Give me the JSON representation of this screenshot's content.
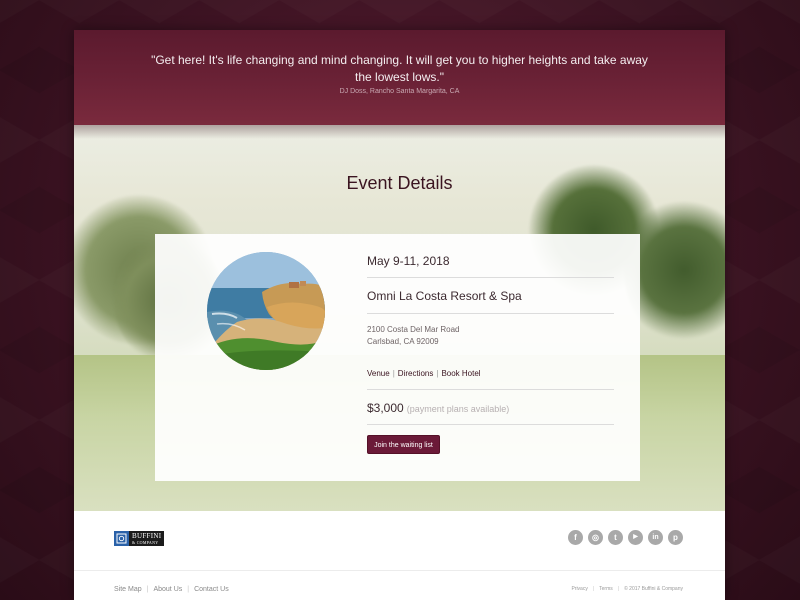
{
  "testimonial": {
    "quote": "\"Get here! It's life changing and mind changing. It will get you to higher heights and take away the lowest lows.\"",
    "author": "DJ Doss, Rancho Santa Margarita, CA"
  },
  "event": {
    "title": "Event Details",
    "date": "May 9-11, 2018",
    "venue": "Omni La Costa Resort & Spa",
    "address_line1": "2100 Costa Del Mar Road",
    "address_line2": "Carlsbad, CA 92009",
    "links": {
      "venue": "Venue",
      "separator": "|",
      "directions": "Directions",
      "book_hotel": "Book Hotel"
    },
    "price": "$3,000",
    "price_note": "(payment plans available)",
    "cta_label": "Join the waiting list"
  },
  "footer": {
    "logo": {
      "line1": "BUFFINI",
      "line2": "& COMPANY"
    },
    "social_icons": [
      {
        "name": "facebook-icon",
        "glyph": "f"
      },
      {
        "name": "instagram-icon",
        "glyph": "◎"
      },
      {
        "name": "twitter-icon",
        "glyph": "t"
      },
      {
        "name": "youtube-icon",
        "glyph": "▶"
      },
      {
        "name": "linkedin-icon",
        "glyph": "in"
      },
      {
        "name": "pinterest-icon",
        "glyph": "p"
      }
    ],
    "links": [
      "Site Map",
      "About Us",
      "Contact Us"
    ],
    "legal": {
      "privacy": "Privacy",
      "terms": "Terms",
      "copyright": "© 2017 Buffini & Company"
    }
  },
  "colors": {
    "brand_maroon": "#6b1a38",
    "testimonial_bg": "#6b2236",
    "page_bg": "#3a1221",
    "social_gray": "#a9a9a9"
  }
}
